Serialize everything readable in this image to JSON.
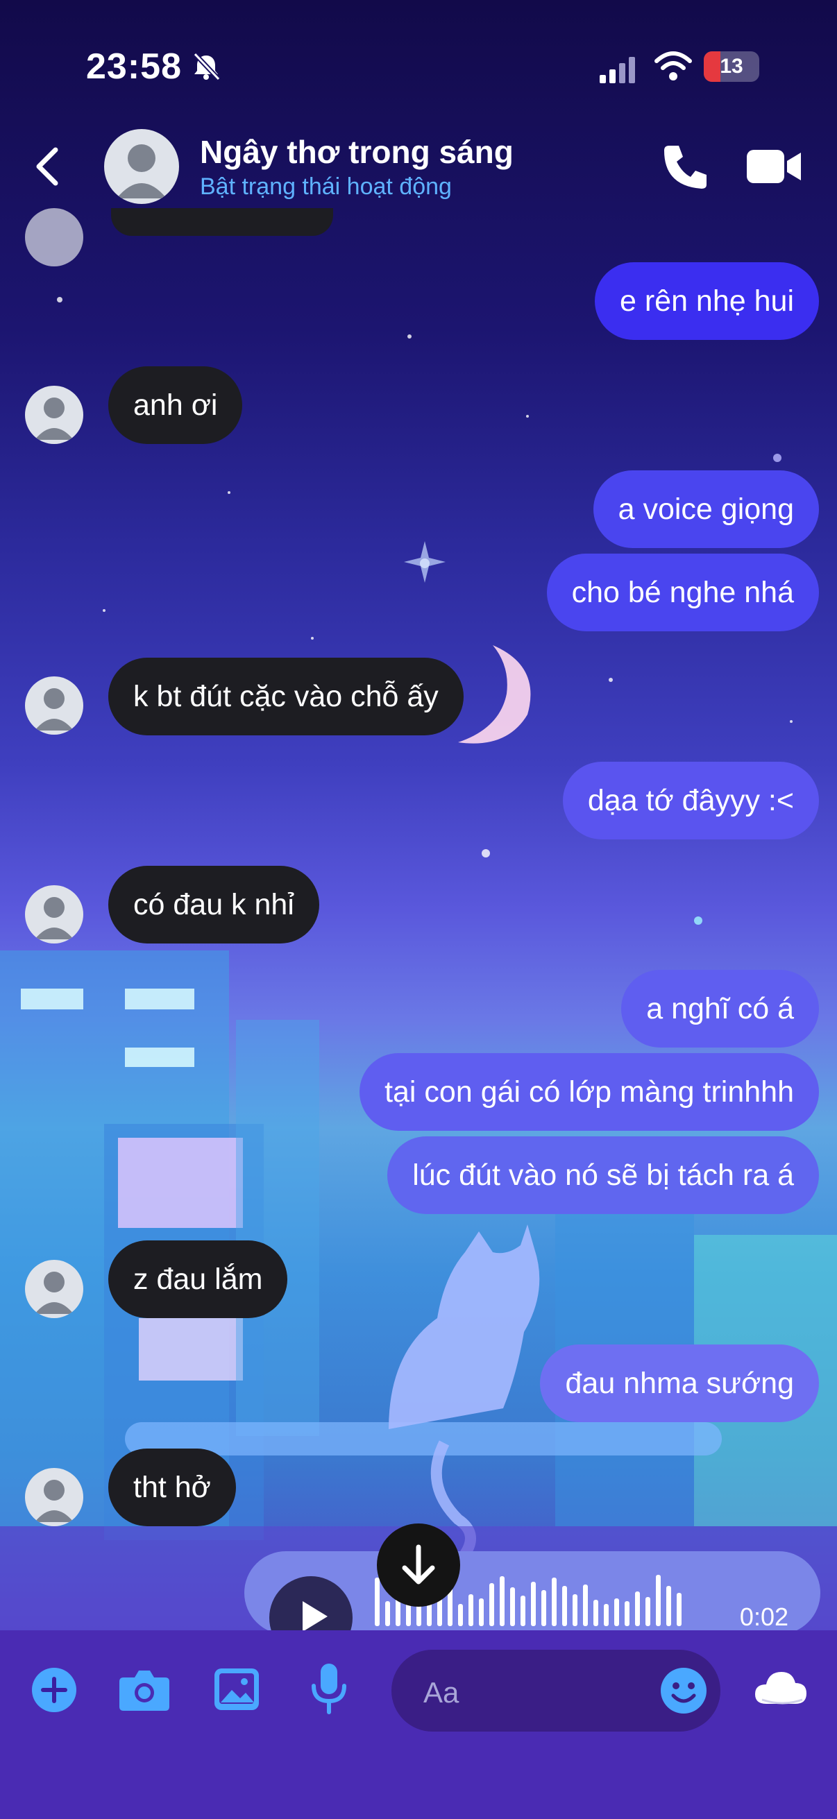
{
  "status_bar": {
    "time": "23:58",
    "battery": "13",
    "battery_level": 0.13
  },
  "header": {
    "title": "Ngây thơ trong sáng",
    "subtitle": "Bật trạng thái hoạt động"
  },
  "messages": [
    {
      "side": "out",
      "text": "e rên nhẹ hui"
    },
    {
      "side": "in",
      "text": "anh ơi"
    },
    {
      "side": "out",
      "text": "a voice giọng"
    },
    {
      "side": "out",
      "text": "cho bé nghe nhá"
    },
    {
      "side": "in",
      "text": "k bt đút cặc vào chỗ ấy"
    },
    {
      "side": "out",
      "text": "dạa tớ đâyyy :<"
    },
    {
      "side": "in",
      "text": "có đau k nhỉ"
    },
    {
      "side": "out",
      "text": "a nghĩ có á"
    },
    {
      "side": "out",
      "text": "tại con gái có lớp màng trinhhh"
    },
    {
      "side": "out",
      "text": "lúc đút vào nó sẽ bị tách ra á"
    },
    {
      "side": "in",
      "text": "z đau lắm"
    },
    {
      "side": "out",
      "text": "đau nhma sướng"
    },
    {
      "side": "in",
      "text": "tht hở"
    }
  ],
  "voice_message": {
    "duration": "0:02"
  },
  "composer": {
    "placeholder": "Aa"
  },
  "colors": {
    "outgoing": "#4a3ff0",
    "incoming": "#1d1d22",
    "accent_blue": "#5fb2ff",
    "composer_bg": "#4a2bb3"
  }
}
